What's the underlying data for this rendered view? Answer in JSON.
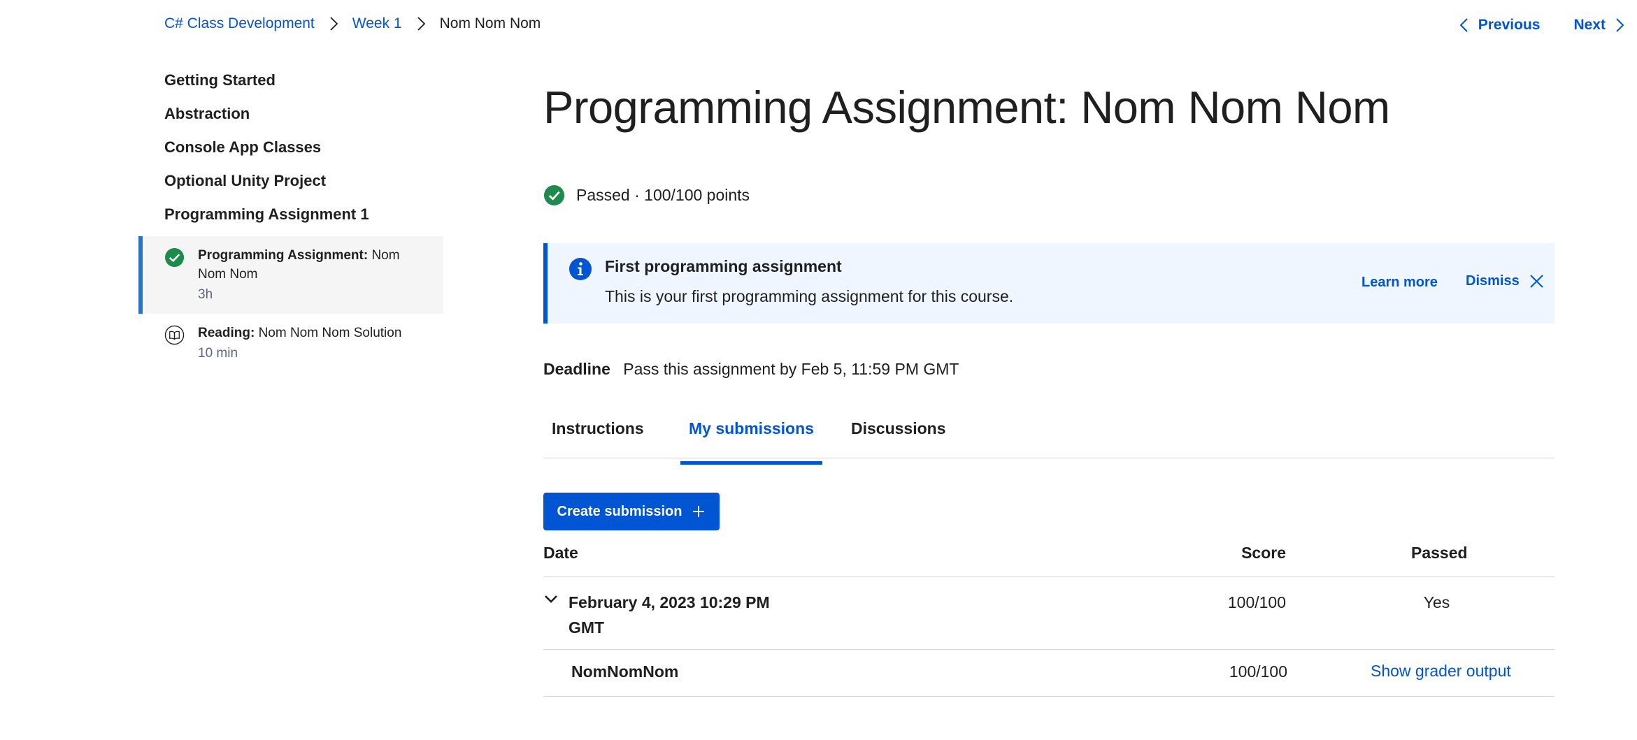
{
  "breadcrumb": {
    "course": "C# Class Development",
    "week": "Week 1",
    "current": "Nom Nom Nom"
  },
  "nav": {
    "previous": "Previous",
    "next": "Next"
  },
  "sidebar": {
    "sections": [
      "Getting Started",
      "Abstraction",
      "Console App Classes",
      "Optional Unity Project",
      "Programming Assignment 1"
    ],
    "items": [
      {
        "kind": "Programming Assignment:",
        "name": "Nom Nom Nom",
        "duration": "3h",
        "icon": "check-circle-icon",
        "active": true
      },
      {
        "kind": "Reading:",
        "name": "Nom Nom Nom Solution",
        "duration": "10 min",
        "icon": "book-icon",
        "active": false
      }
    ]
  },
  "main": {
    "title": "Programming Assignment: Nom Nom Nom",
    "status": "Passed · 100/100 points",
    "banner": {
      "title": "First programming assignment",
      "text": "This is your first programming assignment for this course.",
      "learn_more": "Learn more",
      "dismiss": "Dismiss"
    },
    "deadline": {
      "label": "Deadline",
      "text": "Pass this assignment by Feb 5, 11:59 PM GMT"
    },
    "tabs": [
      "Instructions",
      "My submissions",
      "Discussions"
    ],
    "active_tab": "My submissions",
    "create_button": "Create submission",
    "table": {
      "headers": {
        "date": "Date",
        "score": "Score",
        "passed": "Passed"
      },
      "submission": {
        "date": "February 4, 2023 10:29 PM GMT",
        "score": "100/100",
        "passed": "Yes"
      },
      "part": {
        "name": "NomNomNom",
        "score": "100/100",
        "link": "Show grader output"
      }
    }
  },
  "colors": {
    "accent": "#0056d2",
    "success": "#1e8a4c",
    "banner_bg": "#f0f6ff"
  }
}
